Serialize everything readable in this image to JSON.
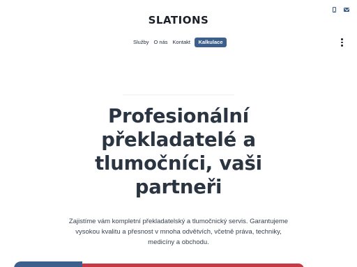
{
  "header": {
    "logo": "SLATIONS",
    "icons": [
      "phone-icon",
      "mail-icon"
    ]
  },
  "nav": {
    "items": [
      "Služby",
      "O nás",
      "Kontakt"
    ],
    "cta": "Kalkulace",
    "menu_icon": "kebab-menu-icon"
  },
  "hero": {
    "title_lines": [
      "Profesionální",
      "překladatelé a",
      "tlumočníci, vaši",
      "partneři"
    ],
    "text_lines": [
      "Zajistíme vám kompletní překladatelský a tlumočnický servis. Garantujeme",
      "vysokou kvalitu a přesnost v mnoha odvětvích, včetně práva, techniky,",
      "medicíny a obchodu."
    ]
  },
  "colors": {
    "brand_blue": "#3c5f8c",
    "accent_red": "#c73a45",
    "text_dark": "#2b3441"
  }
}
